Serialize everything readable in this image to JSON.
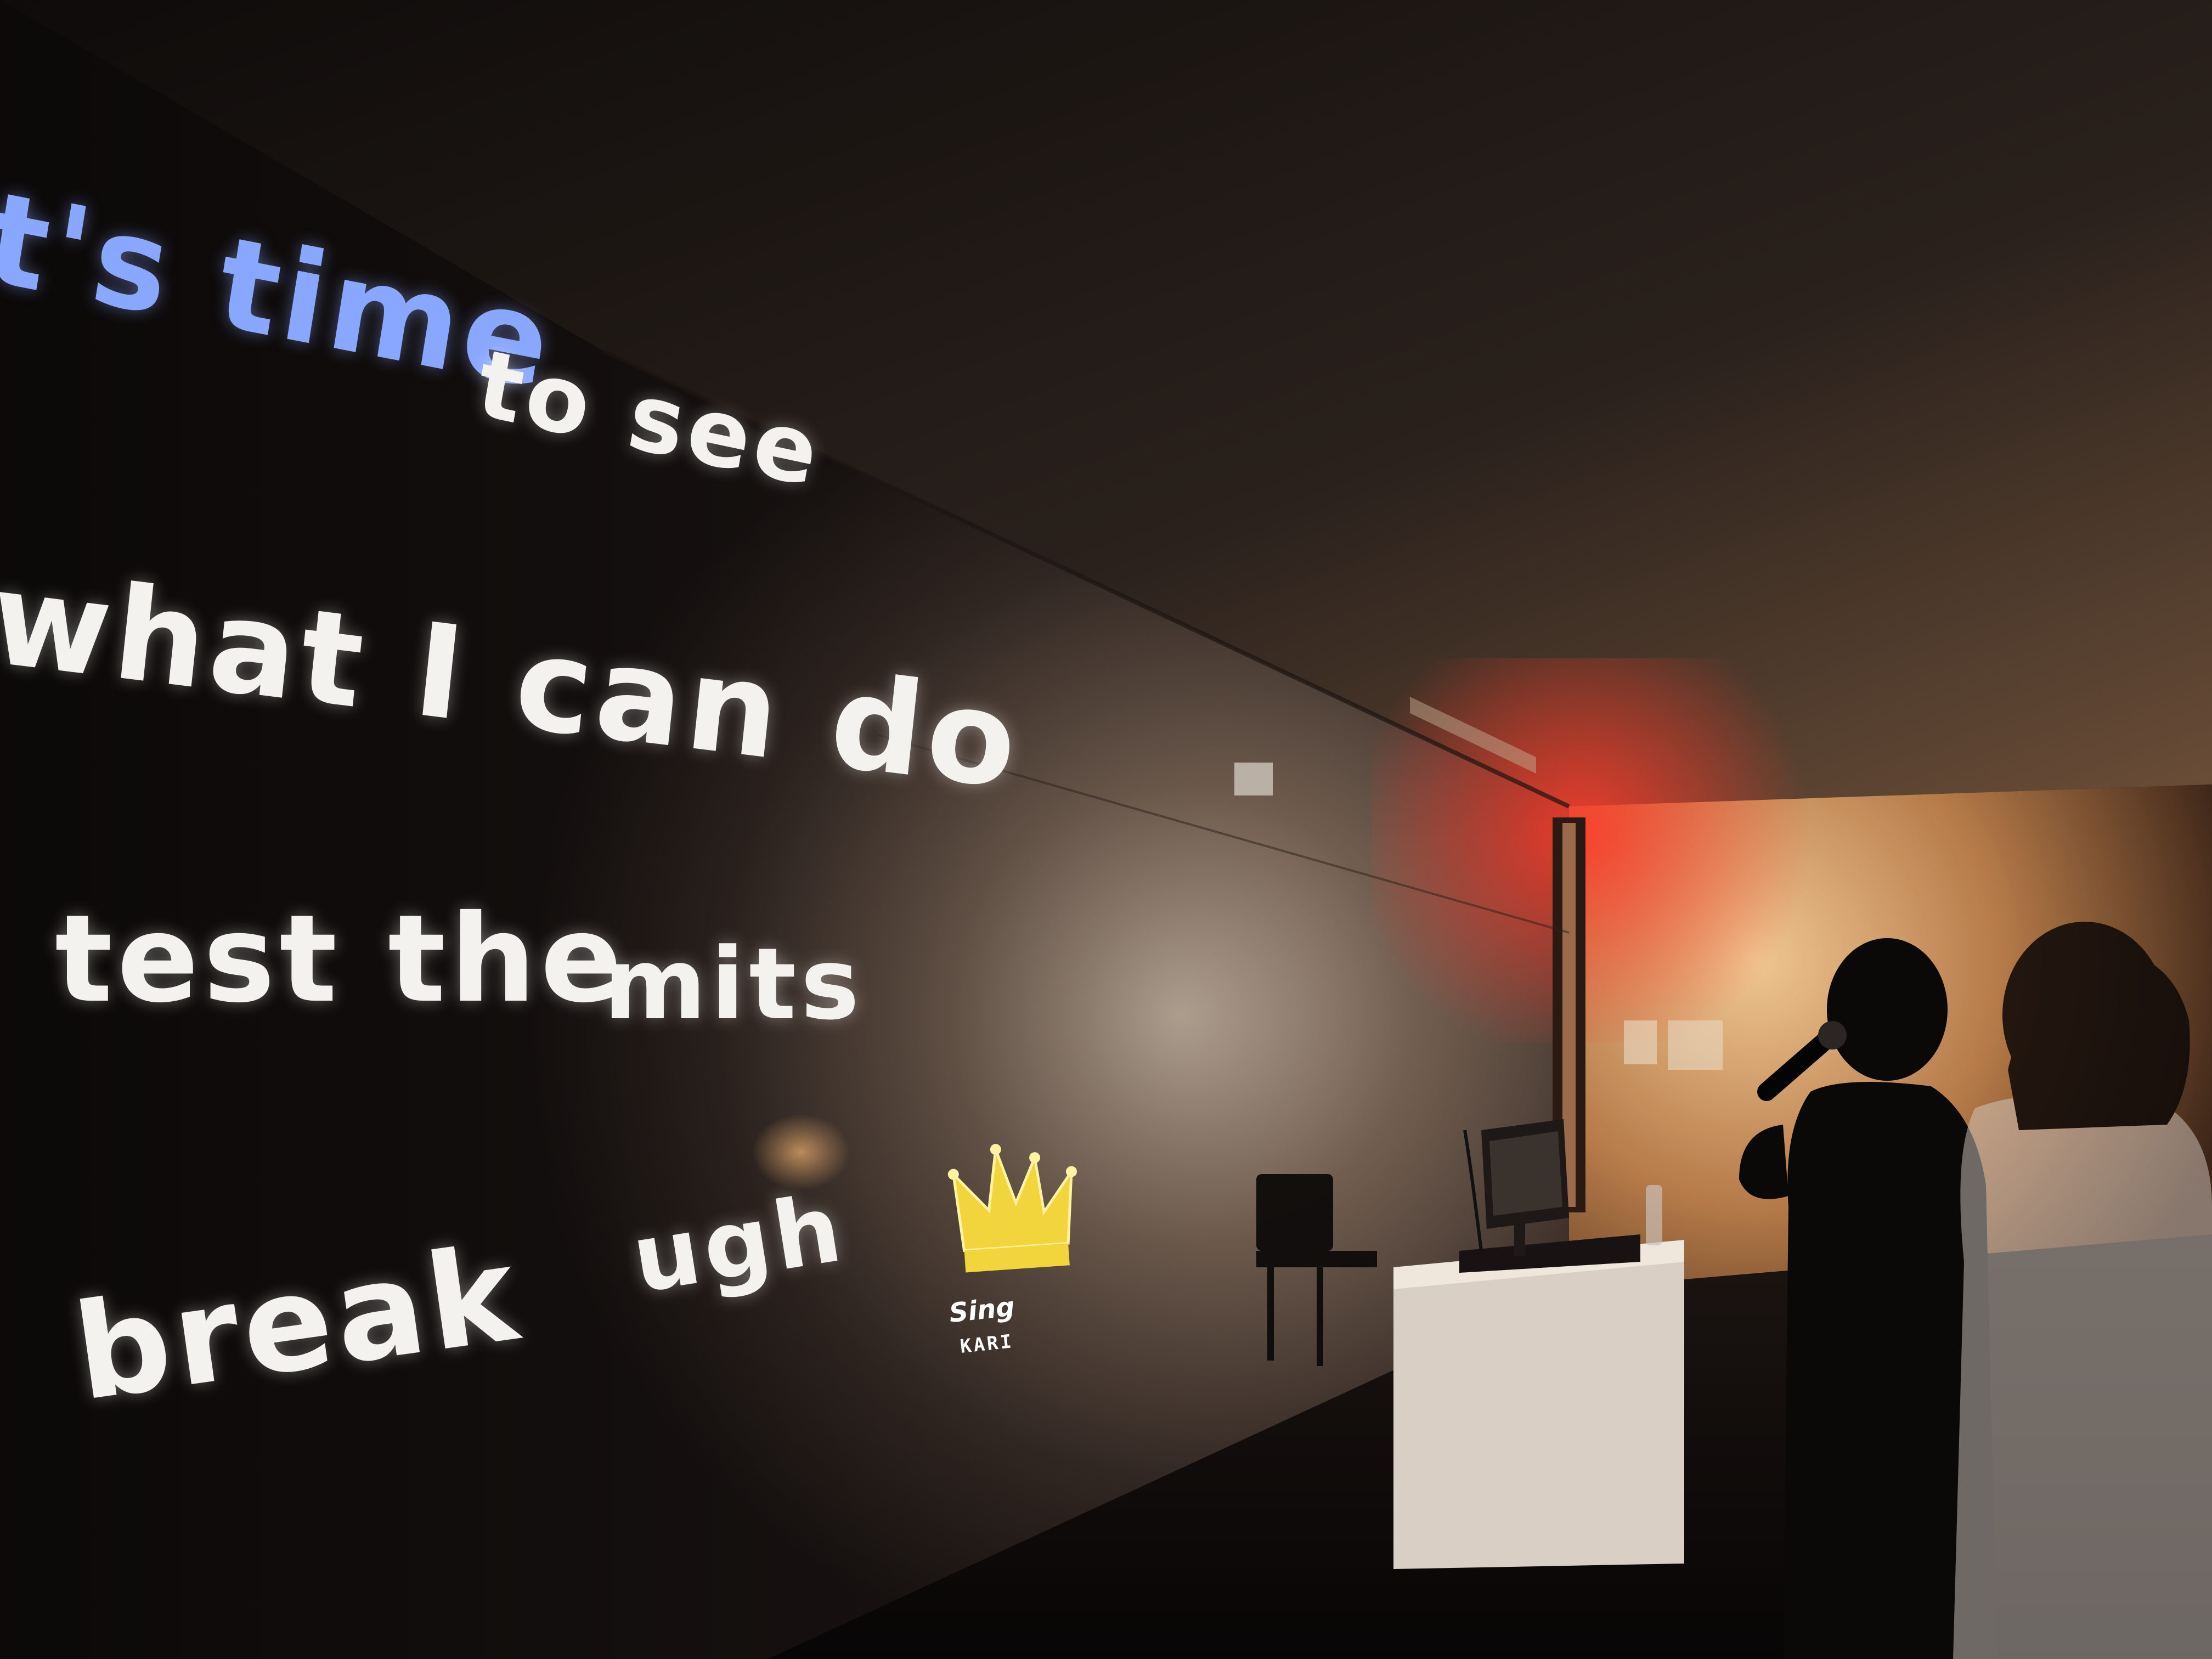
{
  "photo": {
    "subject": "karaoke-room",
    "lyrics": {
      "line1_highlighted": "t's time",
      "line1_rest": "to see",
      "line2": "what I can do",
      "line3_left": "test the",
      "line3_right": "mits",
      "line4_left": "break",
      "line4_right": "ugh"
    },
    "logo": {
      "text_top": "Sing",
      "text_bottom": "KARI",
      "icon": "crown-icon"
    },
    "colors": {
      "lyric_highlight": "#8aa7ff",
      "lyric_text": "#f4f2ee",
      "exit_light": "#ff3b2a",
      "crown": "#f2d43c"
    }
  }
}
